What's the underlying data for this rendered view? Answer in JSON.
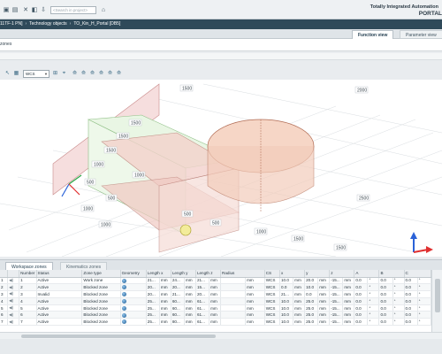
{
  "toolbar": {
    "search_placeholder": "<Search in project>",
    "brand_line1": "Totally Integrated Automation",
    "brand_line2": "PORTAL"
  },
  "breadcrumb": [
    "11TF-1 PN]",
    "Technology objects",
    "TO_Kin_H_Portal [DB5]"
  ],
  "view_tabs": {
    "function_view": "Function view",
    "parameter_view": "Parameter view"
  },
  "section": {
    "label": "zones"
  },
  "view_tools": {
    "coord_system": "WCS"
  },
  "canvas_ticks": [
    "1500",
    "1500",
    "1500",
    "1000",
    "1000",
    "500",
    "500",
    "1000",
    "1000",
    "500",
    "500",
    "1000",
    "1500",
    "1500",
    "2000",
    "2500",
    "1500"
  ],
  "lower_tabs": {
    "workspace": "Workspace zones",
    "kinematics": "Kinematics zones"
  },
  "table": {
    "headers": [
      "",
      "",
      "Number",
      "Status",
      "Zone type",
      "Geometry",
      "Length x",
      "",
      "Length y",
      "",
      "Length z",
      "",
      "Radius",
      "",
      "CS",
      "x",
      "",
      "y",
      "",
      "z",
      "",
      "A",
      "",
      "B",
      "",
      "C",
      ""
    ],
    "rows": [
      [
        "1",
        "1",
        "Active",
        "Work zone",
        "21...",
        "mm",
        "24...",
        "mm",
        "21...",
        "mm",
        "",
        "mm",
        "WCS",
        "10.0",
        "mm",
        "20.0",
        "mm",
        "-15...",
        "mm",
        "0.0",
        "°",
        "0.0",
        "°",
        "0.0",
        "°"
      ],
      [
        "2",
        "2",
        "Active",
        "Blocked zone",
        "20...",
        "mm",
        "20...",
        "mm",
        "15...",
        "mm",
        "",
        "mm",
        "WCS",
        "0.0",
        "mm",
        "10.0",
        "mm",
        "-15...",
        "mm",
        "0.0",
        "°",
        "0.0",
        "°",
        "0.0",
        "°"
      ],
      [
        "3",
        "3",
        "Invalid",
        "Blocked zone",
        "20...",
        "mm",
        "21...",
        "mm",
        "20...",
        "mm",
        "",
        "mm",
        "WCS",
        "21...",
        "mm",
        "0.0",
        "mm",
        "-15...",
        "mm",
        "0.0",
        "°",
        "0.0",
        "°",
        "0.0",
        "°"
      ],
      [
        "4",
        "4",
        "Active",
        "Blocked zone",
        "25...",
        "mm",
        "60...",
        "mm",
        "61...",
        "mm",
        "",
        "mm",
        "WCS",
        "10.0",
        "mm",
        "25.0",
        "mm",
        "-15...",
        "mm",
        "0.0",
        "°",
        "0.0",
        "°",
        "0.0",
        "°"
      ],
      [
        "5",
        "5",
        "Active",
        "Blocked zone",
        "25...",
        "mm",
        "60...",
        "mm",
        "61...",
        "mm",
        "",
        "mm",
        "WCS",
        "10.0",
        "mm",
        "25.0",
        "mm",
        "-15...",
        "mm",
        "0.0",
        "°",
        "0.0",
        "°",
        "0.0",
        "°"
      ],
      [
        "6",
        "6",
        "Active",
        "Blocked zone",
        "25...",
        "mm",
        "60...",
        "mm",
        "61...",
        "mm",
        "",
        "mm",
        "WCS",
        "10.0",
        "mm",
        "25.0",
        "mm",
        "-15...",
        "mm",
        "0.0",
        "°",
        "0.0",
        "°",
        "0.0",
        "°"
      ],
      [
        "7",
        "7",
        "Active",
        "Blocked zone",
        "25...",
        "mm",
        "80...",
        "mm",
        "61...",
        "mm",
        "",
        "mm",
        "WCS",
        "10.0",
        "mm",
        "25.0",
        "mm",
        "-15...",
        "mm",
        "0.0",
        "°",
        "0.0",
        "°",
        "0.0",
        "°"
      ]
    ]
  },
  "colors": {
    "breadcrumb_bg": "#2f4a5a",
    "work_zone": "#7fcf7f",
    "blocked_zone": "#e39b9b",
    "sphere_zone": "#f2c6a8"
  }
}
